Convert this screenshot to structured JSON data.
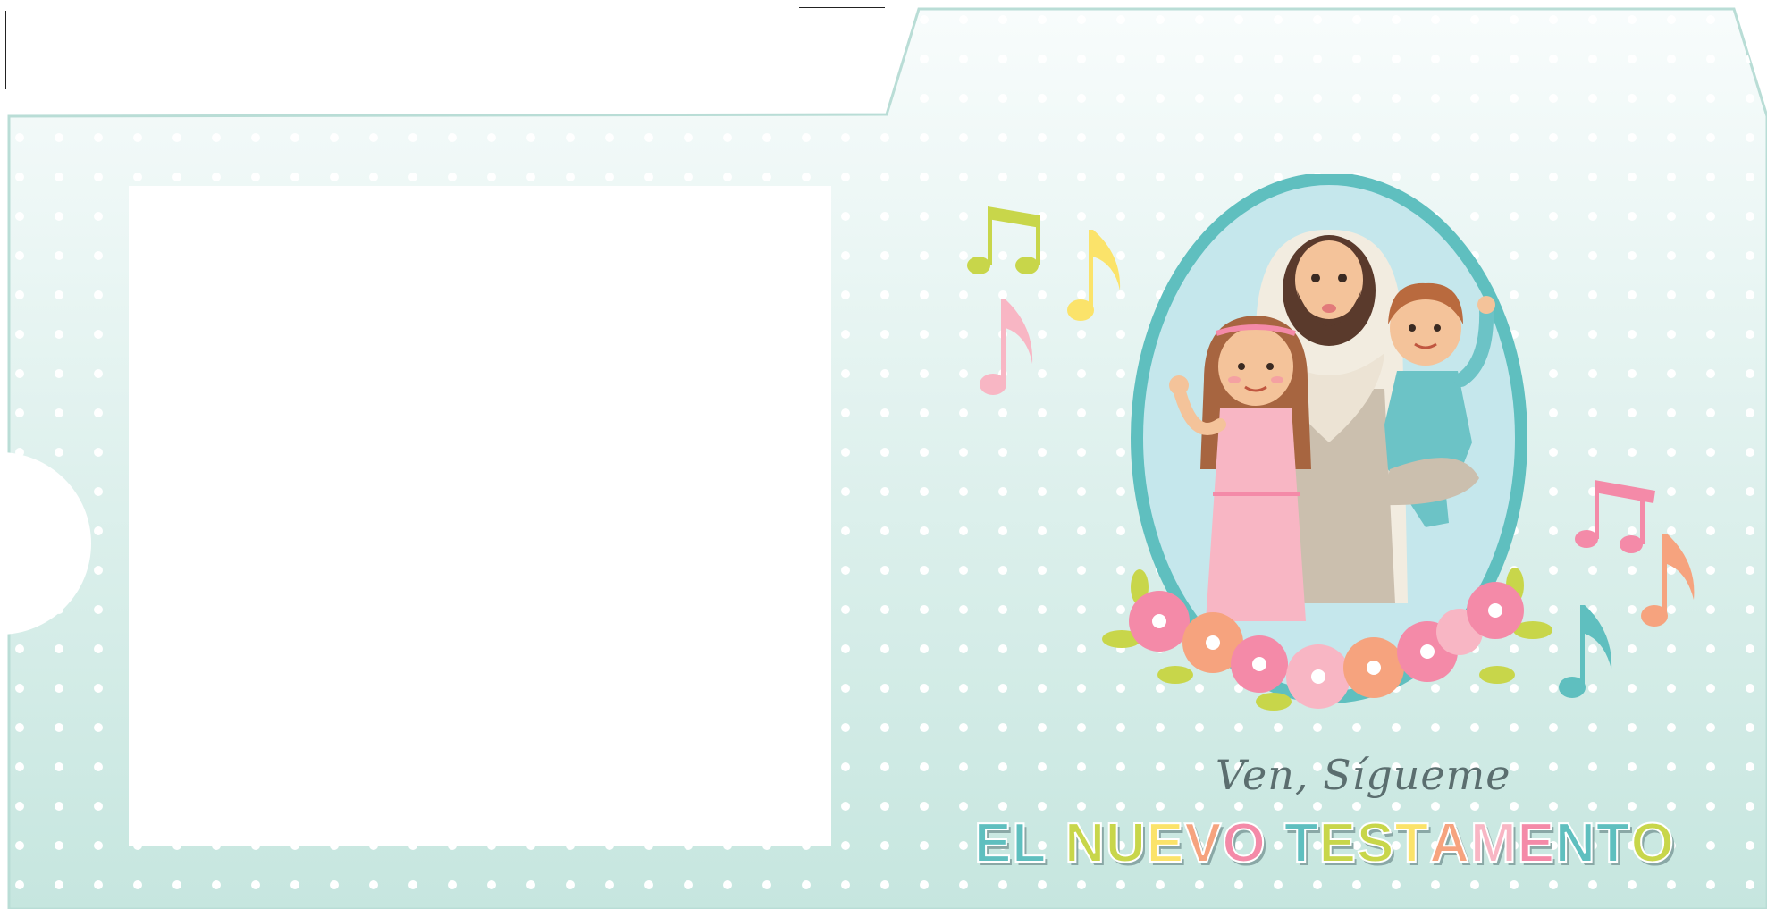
{
  "cover": {
    "subtitle": "Ven, Sígueme",
    "title_letters": [
      {
        "ch": "E",
        "color": "#5fbfbf"
      },
      {
        "ch": "L",
        "color": "#5fbfbf"
      },
      {
        "ch": " ",
        "color": "#ffffff"
      },
      {
        "ch": "N",
        "color": "#c8d64a"
      },
      {
        "ch": "U",
        "color": "#c8d64a"
      },
      {
        "ch": "E",
        "color": "#fbe36a"
      },
      {
        "ch": "V",
        "color": "#f6a37e"
      },
      {
        "ch": "O",
        "color": "#f48aa8"
      },
      {
        "ch": " ",
        "color": "#ffffff"
      },
      {
        "ch": "T",
        "color": "#5fbfbf"
      },
      {
        "ch": "E",
        "color": "#c8d64a"
      },
      {
        "ch": "S",
        "color": "#c8d64a"
      },
      {
        "ch": "T",
        "color": "#fbe36a"
      },
      {
        "ch": "A",
        "color": "#f6a37e"
      },
      {
        "ch": "M",
        "color": "#f8b6c4"
      },
      {
        "ch": "E",
        "color": "#f48aa8"
      },
      {
        "ch": "N",
        "color": "#5fbfbf"
      },
      {
        "ch": "T",
        "color": "#5fbfbf"
      },
      {
        "ch": "O",
        "color": "#c8d64a"
      }
    ]
  },
  "colors": {
    "folder_top": "#f6fbfb",
    "folder_bottom": "#c6e6df",
    "folder_outline": "#b9ddd6",
    "frame_teal": "#5fbfbf",
    "frame_inner": "#c5e7ec",
    "note_green": "#c8d64a",
    "note_yellow": "#fbe36a",
    "note_pink": "#f8b6c4",
    "note_rose": "#f48aa8",
    "note_orange": "#f6a37e",
    "note_teal": "#5fbfbf"
  }
}
